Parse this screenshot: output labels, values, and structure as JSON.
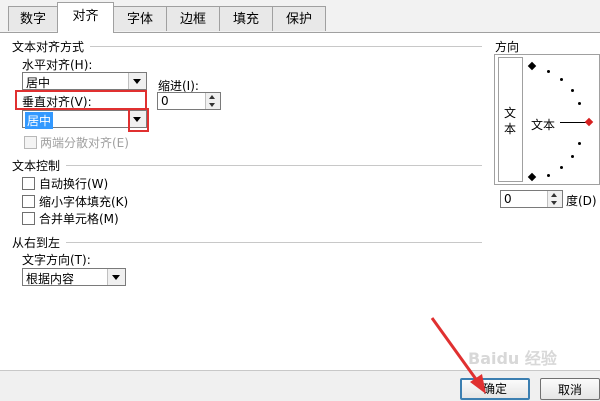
{
  "tabs": [
    "数字",
    "对齐",
    "字体",
    "边框",
    "填充",
    "保护"
  ],
  "active_tab": "对齐",
  "text_align": {
    "title": "文本对齐方式",
    "horizontal_label": "水平对齐(H):",
    "horizontal_value": "居中",
    "indent_label": "缩进(I):",
    "indent_value": "0",
    "vertical_label": "垂直对齐(V):",
    "vertical_value": "居中",
    "justify_distributed_label": "两端分散对齐(E)"
  },
  "text_control": {
    "title": "文本控制",
    "wrap_text": "自动换行(W)",
    "shrink_to_fit": "缩小字体填充(K)",
    "merge_cells": "合并单元格(M)"
  },
  "rtl": {
    "title": "从右到左",
    "direction_label": "文字方向(T):",
    "direction_value": "根据内容"
  },
  "orientation": {
    "title": "方向",
    "vertical_text_char1": "文",
    "vertical_text_char2": "本",
    "horizontal_text": "文本",
    "degree_value": "0",
    "degree_label": "度(D)"
  },
  "buttons": {
    "ok": "确定",
    "cancel": "取消"
  },
  "highlight_color": "#e03030",
  "watermark_text": "Baidu 经验"
}
